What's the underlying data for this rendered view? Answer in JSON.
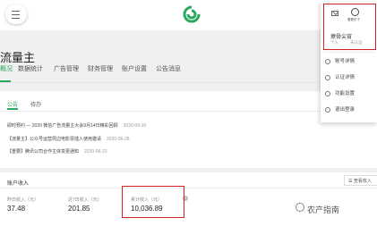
{
  "brand": {
    "accent": "#2aa85e",
    "highlight": "#d32020"
  },
  "page": {
    "title": "流量主"
  },
  "nav": {
    "tabs": [
      "概况",
      "数据统计",
      "广告管理",
      "财务管理",
      "账户设置",
      "公告消息"
    ]
  },
  "announcement": {
    "tabs": [
      "公告",
      "待办"
    ],
    "items": [
      {
        "text": "即时预约 — 2020 微信广告流量主大会9月14日精彩回顾",
        "date": "2020-09-10"
      },
      {
        "text": "【流量主】公众号运营周边电影票插入使用邀请",
        "date": "2020-06-26"
      },
      {
        "text": "【重要】腾讯公司合作主体变更通知",
        "date": "2020-06-23"
      }
    ]
  },
  "account": {
    "title": "账户收入",
    "view_button": "查看收入",
    "stats": [
      {
        "label": "昨日收入（元）",
        "value": "37.48"
      },
      {
        "label": "近7日收入（元）",
        "value": "201.85"
      },
      {
        "label": "累计收入（元）",
        "value": "10,036.89"
      }
    ]
  },
  "dropdown": {
    "avatar_name": "看看东子",
    "name": "撩骨尖宵",
    "type": "个人",
    "status": "未认证",
    "items": [
      "账号详情",
      "认证详情",
      "功能设置",
      "退出登录"
    ]
  },
  "watermark": "农产指南"
}
